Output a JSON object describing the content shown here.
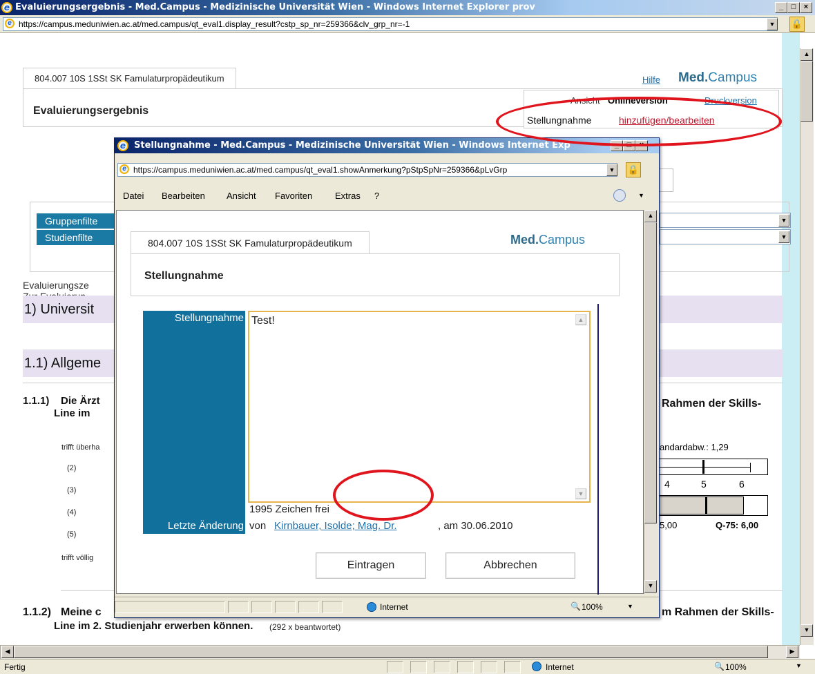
{
  "main_window": {
    "title": "Evaluierungsergebnis - Med.Campus - Medizinische Universität Wien - Windows Internet Explorer prov",
    "url": "https://campus.meduniwien.ac.at/med.campus/qt_eval1.display_result?cstp_sp_nr=259366&clv_grp_nr=-1",
    "status_left": "Fertig",
    "status_zone": "Internet",
    "zoom": "100%"
  },
  "page": {
    "course_tab": "804.007 10S 1SSt SK Famulaturpropädeutikum",
    "help_link": "Hilfe",
    "logo_main": "Med.",
    "logo_sub": "Campus",
    "heading": "Evaluierungsergebnis",
    "view_label": "Ansicht",
    "view_online": "Onlineversion",
    "view_print": "Druckversion",
    "statement_label": "Stellungnahme",
    "statement_link": "hinzufügen/bearbeiten",
    "filter_group": "Gruppenfilte",
    "filter_study": "Studienfilte",
    "eval_time": "Evaluierungsze",
    "eval_for": "Zur Evaluierun",
    "section1": "1) Universit",
    "section11": "1.1) Allgeme",
    "q1_num": "1.1.1)",
    "q1_text": "Die Ärzt",
    "q1_line2": "Line im",
    "q1_right": "Rahmen der Skills-",
    "scale_top": "trifft überha",
    "scale_2": "(2)",
    "scale_3": "(3)",
    "scale_4": "(4)",
    "scale_5": "(5)",
    "scale_bottom": "trifft völlig",
    "stddev": "andardabw.: 1,29",
    "tick4": "4",
    "tick5": "5",
    "tick6": "6",
    "q25_tail": "5,00",
    "q75": "Q-75: 6,00",
    "q2_num": "1.1.2)",
    "q2_text": "Meine c",
    "q2_right": "m Rahmen der Skills-",
    "q2_line2": "Line im 2. Studienjahr erwerben können.",
    "q2_count": "(292 x beantwortet)"
  },
  "popup": {
    "title": "Stellungnahme - Med.Campus - Medizinische Universität Wien - Windows Internet Exp",
    "url": "https://campus.meduniwien.ac.at/med.campus/qt_eval1.showAnmerkung?pStpSpNr=259366&pLvGrp",
    "menu": [
      "Datei",
      "Bearbeiten",
      "Ansicht",
      "Favoriten",
      "Extras",
      "?"
    ],
    "course_tab": "804.007 10S 1SSt SK Famulaturpropädeutikum",
    "logo_main": "Med.",
    "logo_sub": "Campus",
    "heading": "Stellungnahme",
    "field_label": "Stellungnahme",
    "textarea_value": "Test!",
    "chars_left": "1995 Zeichen frei",
    "last_change_label": "Letzte Änderung",
    "von": "von",
    "author": "Kirnbauer, Isolde; Mag. Dr.",
    "date": ", am 30.06.2010",
    "submit": "Eintragen",
    "cancel": "Abbrechen",
    "status_zone": "Internet",
    "zoom": "100%"
  },
  "annotation_color": "#e0141c"
}
